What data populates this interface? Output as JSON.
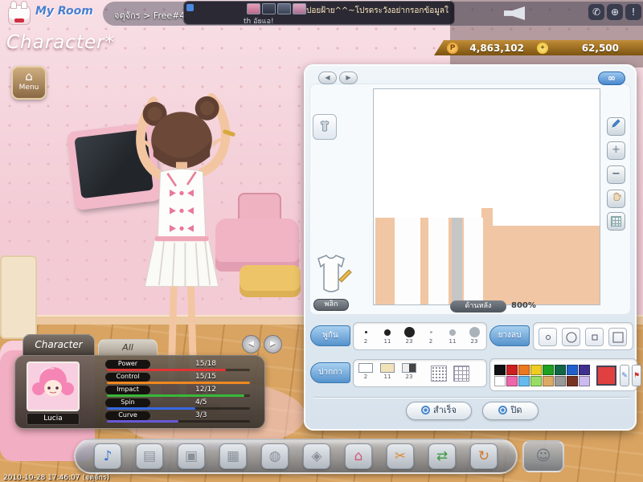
{
  "top_bar": {
    "logo_text": "My Room",
    "breadcrumb": "จตุจักร > Free#4",
    "chat": {
      "line1": "ปอยฝ้าย^^~โปรดระวังอย่ากรอกข้อมูลใ",
      "line2": "th อัยแอ!"
    }
  },
  "system_icons": {
    "mobile": "✆",
    "globe": "⊕",
    "alert": "!",
    "settings": "⚙"
  },
  "header": {
    "title": "Character*",
    "pang_symbol": "P",
    "pang_value": "4,863,102",
    "point_symbol": "✦",
    "point_value": "62,500"
  },
  "menu": {
    "label": "Menu",
    "house_glyph": "⌂"
  },
  "editor": {
    "nav_back": "◀",
    "nav_forward": "▶",
    "link_glyph": "∞",
    "flip_button": "พลิก",
    "view_name": "ด้านหลัง",
    "zoom": "800%",
    "tabs": {
      "brush": "พู่กัน",
      "pen": "ปากกา",
      "eraser": "ยางลบ"
    },
    "brush_sizes": [
      "2",
      "11",
      "23"
    ],
    "brush_sizes_alt": [
      "2",
      "11",
      "23"
    ],
    "pen_sizes": [
      "2",
      "11",
      "23"
    ],
    "palette_row1": [
      "#111111",
      "#cc2020",
      "#ee7820",
      "#eecc20",
      "#20a020",
      "#116644",
      "#2060cc",
      "#403090"
    ],
    "palette_row2": [
      "#ffffff",
      "#ee66aa",
      "#66bbee",
      "#99dd66",
      "#ddaa66",
      "#999999",
      "#773322",
      "#ccbbee"
    ],
    "current_color": "#e04040",
    "confirm_button": "สำเร็จ",
    "close_button": "ปิด"
  },
  "stats": {
    "tab_character": "Character",
    "tab_all": "All",
    "name": "Lucia",
    "rows": [
      {
        "label": "Power",
        "value": "15/18",
        "color": "#e03434",
        "pct": "83%"
      },
      {
        "label": "Control",
        "value": "15/15",
        "color": "#f08820",
        "pct": "100%"
      },
      {
        "label": "Impact",
        "value": "12/12",
        "color": "#38b838",
        "pct": "96%"
      },
      {
        "label": "Spin",
        "value": "4/5",
        "color": "#3868e0",
        "pct": "62%"
      },
      {
        "label": "Curve",
        "value": "3/3",
        "color": "#6858d8",
        "pct": "50%"
      }
    ]
  },
  "toolbar": {
    "icons": [
      {
        "name": "music",
        "glyph": "♪",
        "color": "#2f6fd0"
      },
      {
        "name": "inventory",
        "glyph": "▤",
        "color": "#8a9098"
      },
      {
        "name": "gift",
        "glyph": "▣",
        "color": "#8a9098"
      },
      {
        "name": "wardrobe",
        "glyph": "▦",
        "color": "#8a9098"
      },
      {
        "name": "cap",
        "glyph": "◍",
        "color": "#8a9098"
      },
      {
        "name": "bag",
        "glyph": "◈",
        "color": "#8a9098"
      },
      {
        "name": "room",
        "glyph": "⌂",
        "color": "#d05878"
      },
      {
        "name": "design",
        "glyph": "✂",
        "color": "#e08830"
      },
      {
        "name": "exchange",
        "glyph": "⇄",
        "color": "#3a9a40"
      },
      {
        "name": "refresh",
        "glyph": "↻",
        "color": "#d07828"
      },
      {
        "name": "figure",
        "glyph": "☺",
        "color": "#6a7078"
      }
    ]
  },
  "footer": {
    "timestamp": "2010-10-28 17:46:07 (จตุจักร)"
  }
}
